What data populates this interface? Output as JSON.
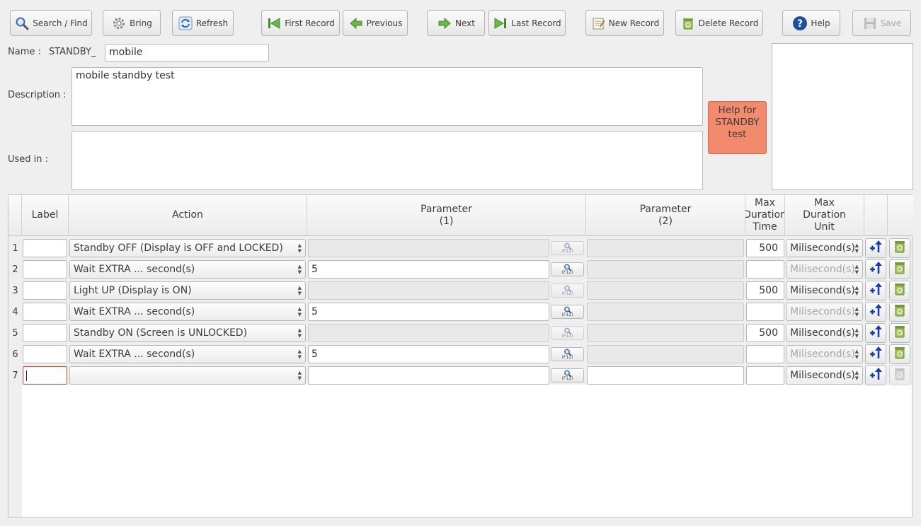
{
  "toolbar": {
    "search_label": "Search / Find",
    "bring_label": "Bring",
    "refresh_label": "Refresh",
    "first_label": "First Record",
    "previous_label": "Previous",
    "next_label": "Next",
    "last_label": "Last Record",
    "new_label": "New Record",
    "delete_label": "Delete Record",
    "help_label": "Help",
    "save_label": "Save"
  },
  "form": {
    "name_label": "Name :",
    "name_prefix": "STANDBY_",
    "name_value": "mobile",
    "description_label": "Description :",
    "description_value": "mobile standby test",
    "used_in_label": "Used in :",
    "used_in_value": "",
    "help_text": "Help for STANDBY test"
  },
  "grid": {
    "headers": {
      "label": "Label",
      "action": "Action",
      "param1": "Parameter\n(1)",
      "param2": "Parameter\n(2)",
      "max_time": "Max\nDuration\nTime",
      "max_unit": "Max\nDuration\nUnit"
    },
    "lookup_hint": "(F12)",
    "rows": [
      {
        "num": "1",
        "label": "",
        "action": "Standby OFF (Display is OFF and LOCKED)",
        "param1": "",
        "param2": "",
        "time": "500",
        "unit": "Milisecond(s)"
      },
      {
        "num": "2",
        "label": "",
        "action": "Wait EXTRA ... second(s)",
        "param1": "5",
        "param2": "",
        "time": "",
        "unit": "Milisecond(s)"
      },
      {
        "num": "3",
        "label": "",
        "action": "Light UP (Display is ON)",
        "param1": "",
        "param2": "",
        "time": "500",
        "unit": "Milisecond(s)"
      },
      {
        "num": "4",
        "label": "",
        "action": "Wait EXTRA ... second(s)",
        "param1": "5",
        "param2": "",
        "time": "",
        "unit": "Milisecond(s)"
      },
      {
        "num": "5",
        "label": "",
        "action": "Standby ON (Screen is UNLOCKED)",
        "param1": "",
        "param2": "",
        "time": "500",
        "unit": "Milisecond(s)"
      },
      {
        "num": "6",
        "label": "",
        "action": "Wait EXTRA ... second(s)",
        "param1": "5",
        "param2": "",
        "time": "",
        "unit": "Milisecond(s)"
      },
      {
        "num": "7",
        "label": "",
        "action": "",
        "param1": "",
        "param2": "",
        "time": "",
        "unit": "Milisecond(s)"
      }
    ]
  },
  "colors": {
    "help_box": "#f28b6d",
    "focus_border": "#d94a3a",
    "arrow_icon": "#1a3ea8",
    "trash_icon": "#8aa84a"
  }
}
